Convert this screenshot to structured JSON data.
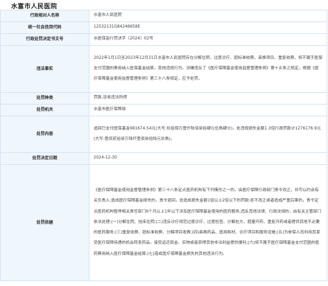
{
  "title": "水富市人民医院",
  "rows": [
    {
      "label": "行政相对人名称",
      "value": "水富市人民医院"
    },
    {
      "label": "统一社会信用代码",
      "value": "12532131G84248658E"
    },
    {
      "label": "行政处罚决定书文号",
      "value": "水医保监行罚决字〔2024〕02号"
    },
    {
      "label": "违法事实",
      "value": "2022年1月1日至2023年12月31日水富市人民医院存在分解住院、过度诊疗、超标准收费、串换项目、重复收费，将不属于医保支付范围的费用纳入医保基金结算，其他违规行为。涉嫌违反了《医疗保障基金使用监督管理条例》第十五条之规定，根据《医疗保障基金使用监督管理条例》第三十八条规定，应予处罚。"
    },
    {
      "label": "处罚种类",
      "value": "罚款,没收违法所得"
    },
    {
      "label": "处罚机关",
      "value": "水富市医疗保障局"
    },
    {
      "label": "处罚内容",
      "value": "追回已支付医保基金981674.54元(大写:玖拾捌万壹仟陆佰柒拾肆元伍角肆分)，处违规损失金额1.3倍行政罚款计1276176.9元(大写:壹佰贰拾柒万陆仟壹佰柒拾陆元玖角)。"
    },
    {
      "label": "处罚决定日期",
      "value": "2024-12-30"
    },
    {
      "label": "处罚依据",
      "value": "《医疗保障基金使用监督管理条例》第三十八条定点医药机构有下列情形之一的，由医疗保障行政部门责令改正，并可以约谈有关负责人;造成医疗保障基金损失的，责令退回，处造成损失金额1倍以上2倍以下的罚款;拒不改正或者造成严重后果的，责令定点医药机构暂停相关责任部门6个月以上1年以下涉及医疗保障基金使用的医药服务;违反其他法律、行政法规的，由有关主管部门依法处理:(一)分解住院、挂床住院;(二)违反诊疗规范过度诊疗、过度检查、分解处方、超量开药、重复开药或者提供其他不必要的医药服务;(三)重复收费、超标准收费、分解项目收费;(四)串换药品、医用耗材、诊疗项目和服务设施;(五)为参保人员利用其享受医疗保障待遇的机会转卖药品，接受返还现金、实物或者获得其他非法利益提供便利;(六)将不属于医疗保障基金支付范围的医药费用纳入医疗保障基金结算;(七)造成医疗保障基金损失的其他违法行为。"
    }
  ]
}
